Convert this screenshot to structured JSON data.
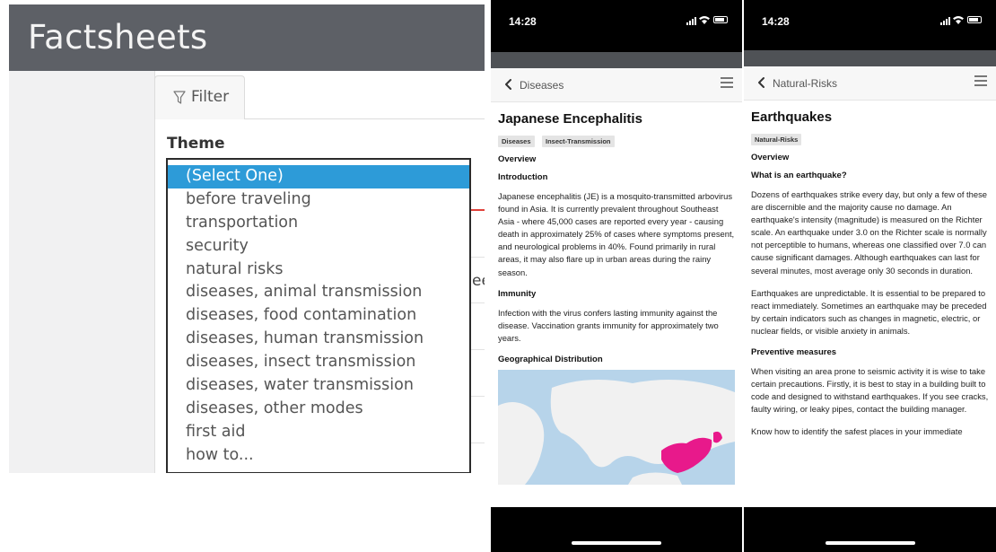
{
  "web": {
    "title": "Factsheets",
    "filter_tab": "Filter",
    "theme_label": "Theme",
    "clipped_text": "ee",
    "dropdown_options": [
      "(Select One)",
      "before traveling",
      "transportation",
      "security",
      "natural risks",
      "diseases, animal transmission",
      "diseases, food contamination",
      "diseases, human transmission",
      "diseases, insect transmission",
      "diseases, water transmission",
      "diseases, other modes",
      "first aid",
      "how to..."
    ],
    "selected_index": 0,
    "colors": {
      "header": "#5d6066",
      "selected": "#2d9bd8",
      "accent_red": "#e0413a"
    }
  },
  "phone1": {
    "time": "14:28",
    "back_label": "Diseases",
    "title": "Japanese Encephalitis",
    "tags": [
      "Diseases",
      "Insect-Transmission"
    ],
    "overview": "Overview",
    "intro_heading": "Introduction",
    "intro_text": "Japanese encephalitis (JE) is a mosquito-transmitted arbovirus found in Asia. It is currently prevalent throughout Southeast Asia - where 45,000 cases are reported every year - causing death in approximately 25% of cases where symptoms present, and neurological problems in 40%. Found primarily in rural areas, it may also flare up in urban areas during the rainy season.",
    "immunity_heading": "Immunity",
    "immunity_text": "Infection with the virus confers lasting immunity against the disease. Vaccination grants immunity for approximately two years.",
    "geo_heading": "Geographical Distribution",
    "map_highlight_color": "#e8198b"
  },
  "phone2": {
    "time": "14:28",
    "back_label": "Natural-Risks",
    "title": "Earthquakes",
    "tags": [
      "Natural-Risks"
    ],
    "overview": "Overview",
    "q_heading": "What is an earthquake?",
    "p1": "Dozens of earthquakes strike every day, but only a few of these are discernible and the majority cause no damage. An earthquake's intensity (magnitude) is measured on the Richter scale. An earthquake under 3.0 on the Richter scale is normally not perceptible to humans, whereas one classified over 7.0 can cause significant damages. Although earthquakes can last for several minutes, most average only 30 seconds in duration.",
    "p2": "Earthquakes are unpredictable. It is essential to be prepared to react immediately. Sometimes an earthquake may be preceded by certain indicators such as changes in magnetic, electric, or nuclear fields, or visible anxiety in animals.",
    "prev_heading": "Preventive measures",
    "p3": "When visiting an area prone to seismic activity it is wise to take certain precautions. Firstly, it is best to stay in a building built to code and designed to withstand earthquakes. If you see cracks, faulty wiring, or leaky pipes, contact the building manager.",
    "p4": "Know how to identify the safest places in your immediate"
  }
}
